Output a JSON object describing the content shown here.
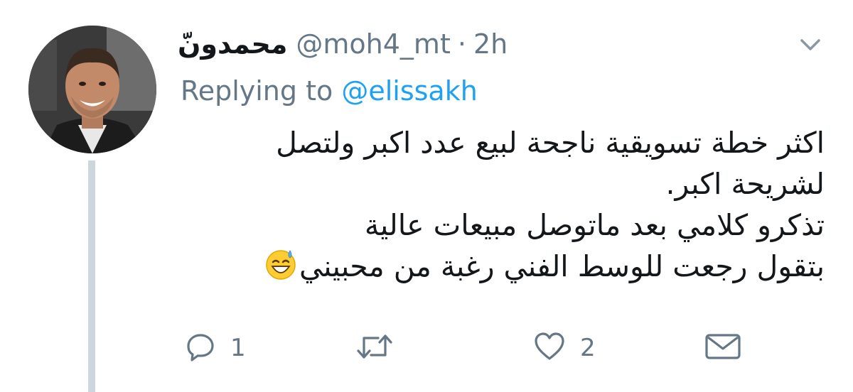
{
  "tweet": {
    "display_name": "محمدونّ",
    "handle": "@moh4_mt",
    "separator": "·",
    "time": "2h",
    "reply_prefix": "Replying to",
    "reply_mention": "@elissakh",
    "body_lines": [
      "اكثر خطة تسويقية ناجحة لبيع عدد اكبر ولتصل",
      "لشريحة اكبر.",
      "تذكرو كلامي بعد ماتوصل مبيعات عالية",
      "بتقول رجعت للوسط الفني رغبة من محبيني"
    ],
    "body_emoji": "sweat-smile-emoji"
  },
  "actions": {
    "reply_count": "1",
    "retweet_count": "",
    "like_count": "2",
    "icons": [
      "reply-icon",
      "retweet-icon",
      "like-icon",
      "dm-icon"
    ]
  },
  "colors": {
    "text": "#14171a",
    "muted": "#657786",
    "link": "#1da1f2",
    "thread_line": "#ccd6dd"
  }
}
